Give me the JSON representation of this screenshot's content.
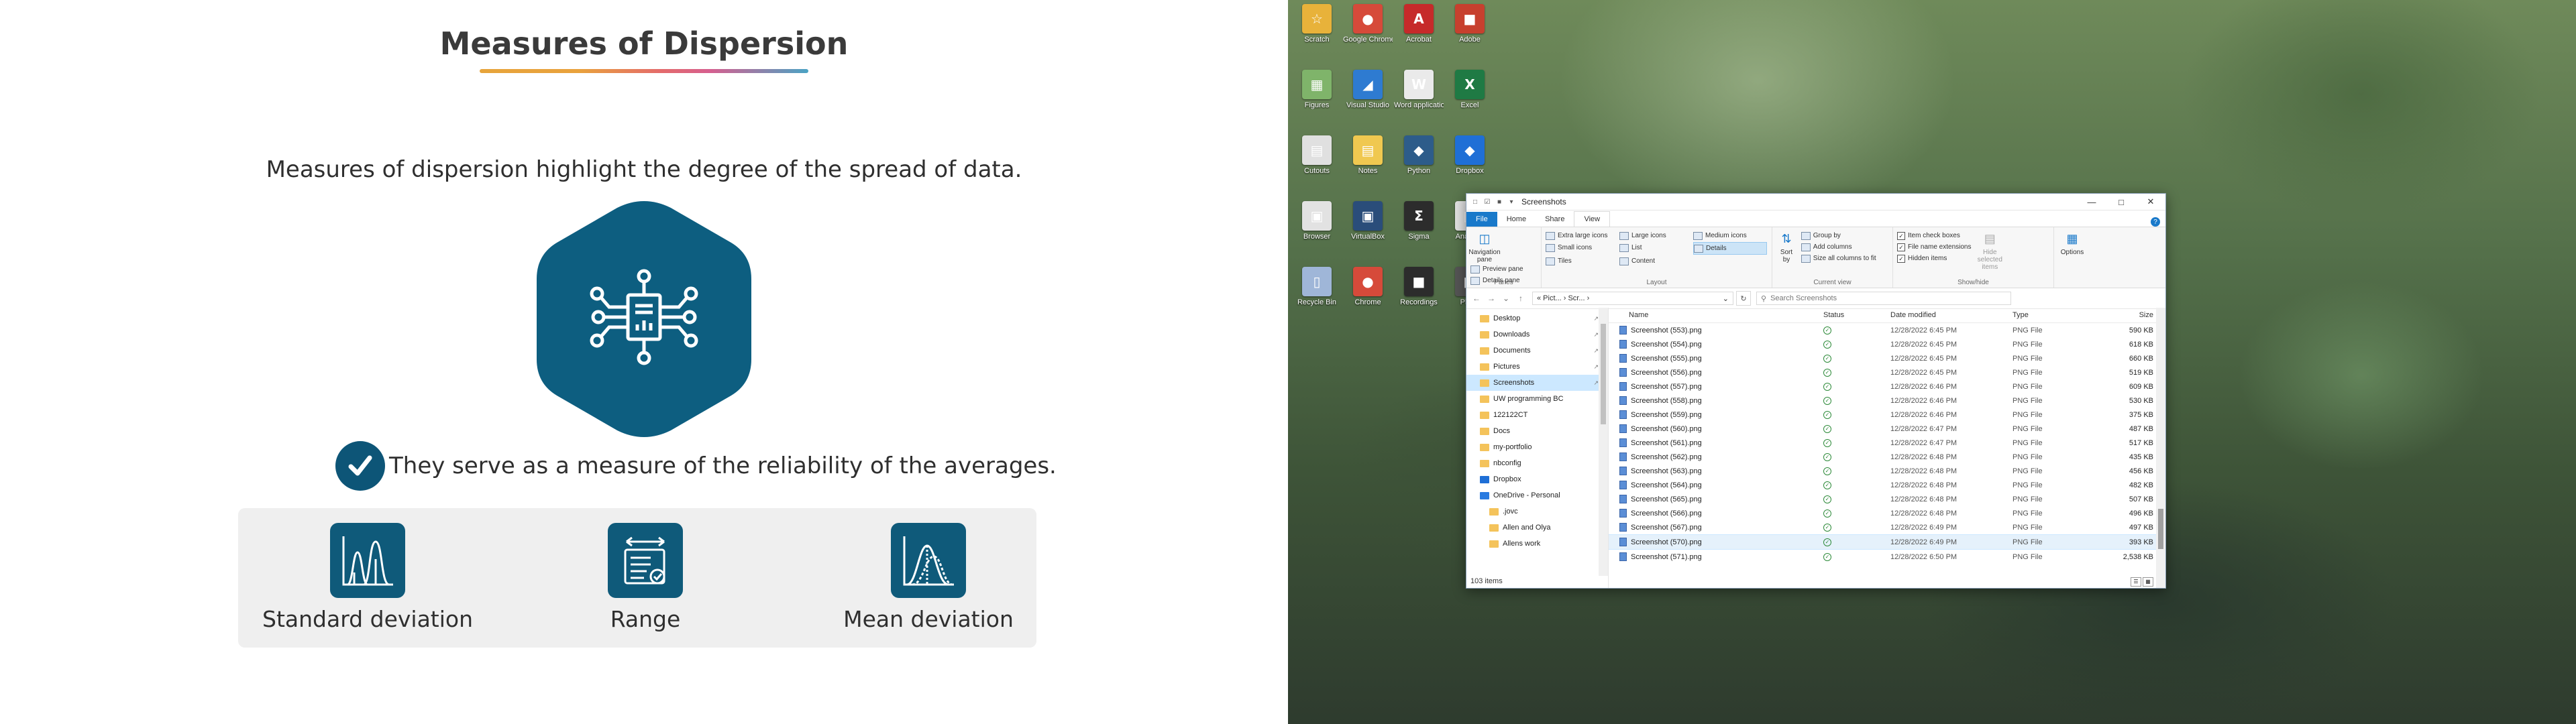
{
  "slide": {
    "title": "Measures of Dispersion",
    "lead": "Measures of dispersion highlight the degree of the spread of data.",
    "point": "They serve as a measure of the reliability of the averages.",
    "measures": [
      {
        "label": "Standard deviation",
        "icon": "bell-curves-icon"
      },
      {
        "label": "Range",
        "icon": "range-list-icon"
      },
      {
        "label": "Mean deviation",
        "icon": "distribution-curves-icon"
      }
    ],
    "colors": {
      "accent": "#0f5a7a",
      "panel": "#efefef"
    }
  },
  "desktop": {
    "icons": [
      {
        "label": "Scratch",
        "glyph": "☆",
        "color": "#e8b23a"
      },
      {
        "label": "Google Chrome",
        "glyph": "●",
        "color": "#d64a3a"
      },
      {
        "label": "Acrobat",
        "glyph": "A",
        "color": "#c62a2a"
      },
      {
        "label": "Adobe",
        "glyph": "■",
        "color": "#c7402e"
      },
      {
        "label": "Figures",
        "glyph": "▦",
        "color": "#7fb46a"
      },
      {
        "label": "Visual Studio",
        "glyph": "◢",
        "color": "#2e7bd1"
      },
      {
        "label": "Word application",
        "glyph": "W",
        "color": "#eaeaea"
      },
      {
        "label": "Excel",
        "glyph": "X",
        "color": "#1f7a44"
      },
      {
        "label": "Cutouts",
        "glyph": "▤",
        "color": "#e0e0e0"
      },
      {
        "label": "Notes",
        "glyph": "▤",
        "color": "#f0c850"
      },
      {
        "label": "Python",
        "glyph": "◆",
        "color": "#2d5c8a"
      },
      {
        "label": "Dropbox",
        "glyph": "◆",
        "color": "#1f6fd6"
      },
      {
        "label": "Browser",
        "glyph": "▣",
        "color": "#e2e2e2"
      },
      {
        "label": "VirtualBox",
        "glyph": "▣",
        "color": "#2a4d7a"
      },
      {
        "label": "Sigma",
        "glyph": "Σ",
        "color": "#2c2c2c"
      },
      {
        "label": "Analyser",
        "glyph": "▥",
        "color": "#e2e2e2"
      },
      {
        "label": "Recycle Bin",
        "glyph": "▯",
        "color": "#9fb6d8"
      },
      {
        "label": "Chrome",
        "glyph": "●",
        "color": "#d64a3a"
      },
      {
        "label": "Recordings",
        "glyph": "■",
        "color": "#2c2c2c"
      },
      {
        "label": "Photo",
        "glyph": "■",
        "color": "#555555"
      }
    ]
  },
  "explorer": {
    "window_title": "Screenshots",
    "tabs": [
      "File",
      "Home",
      "Share",
      "View"
    ],
    "ribbon": {
      "panes_label": "Panes",
      "nav_pane": "Navigation pane",
      "preview_pane": "Preview pane",
      "details_pane": "Details pane",
      "layout_label": "Layout",
      "layout_items": [
        "Extra large icons",
        "Large icons",
        "Medium icons",
        "Small icons",
        "List",
        "Details",
        "Tiles",
        "Content"
      ],
      "current_view_label": "Current view",
      "sort_by": "Sort by",
      "group_by": "Group by",
      "add_columns": "Add columns",
      "size_all_columns": "Size all columns to fit",
      "showhide_label": "Show/hide",
      "item_check_boxes": "Item check boxes",
      "file_name_extensions": "File name extensions",
      "hidden_items": "Hidden items",
      "hide_selected": "Hide selected items",
      "options": "Options"
    },
    "path": "« Pict... › Scr... ›",
    "search_placeholder": "Search Screenshots",
    "nav": [
      {
        "label": "Desktop",
        "pinned": true
      },
      {
        "label": "Downloads",
        "pinned": true
      },
      {
        "label": "Documents",
        "pinned": true
      },
      {
        "label": "Pictures",
        "pinned": true
      },
      {
        "label": "Screenshots",
        "pinned": true
      },
      {
        "label": "UW programming BC",
        "pinned": false
      },
      {
        "label": "122122CT",
        "pinned": false
      },
      {
        "label": "Docs",
        "pinned": false
      },
      {
        "label": "my-portfolio",
        "pinned": false
      },
      {
        "label": "nbconfig",
        "pinned": false
      },
      {
        "label": "Dropbox",
        "pinned": false
      },
      {
        "label": "OneDrive - Personal",
        "pinned": false
      },
      {
        "label": ".jovc",
        "pinned": false
      },
      {
        "label": "Allen and Olya",
        "pinned": false
      },
      {
        "label": "Allens work",
        "pinned": false
      }
    ],
    "item_count": "103 items",
    "columns": [
      "Name",
      "Status",
      "Date modified",
      "Type",
      "Size"
    ],
    "files": [
      {
        "name": "Screenshot (553).png",
        "date": "12/28/2022 6:45 PM",
        "type": "PNG File",
        "size": "590 KB"
      },
      {
        "name": "Screenshot (554).png",
        "date": "12/28/2022 6:45 PM",
        "type": "PNG File",
        "size": "618 KB"
      },
      {
        "name": "Screenshot (555).png",
        "date": "12/28/2022 6:45 PM",
        "type": "PNG File",
        "size": "660 KB"
      },
      {
        "name": "Screenshot (556).png",
        "date": "12/28/2022 6:45 PM",
        "type": "PNG File",
        "size": "519 KB"
      },
      {
        "name": "Screenshot (557).png",
        "date": "12/28/2022 6:46 PM",
        "type": "PNG File",
        "size": "609 KB"
      },
      {
        "name": "Screenshot (558).png",
        "date": "12/28/2022 6:46 PM",
        "type": "PNG File",
        "size": "530 KB"
      },
      {
        "name": "Screenshot (559).png",
        "date": "12/28/2022 6:46 PM",
        "type": "PNG File",
        "size": "375 KB"
      },
      {
        "name": "Screenshot (560).png",
        "date": "12/28/2022 6:47 PM",
        "type": "PNG File",
        "size": "487 KB"
      },
      {
        "name": "Screenshot (561).png",
        "date": "12/28/2022 6:47 PM",
        "type": "PNG File",
        "size": "517 KB"
      },
      {
        "name": "Screenshot (562).png",
        "date": "12/28/2022 6:48 PM",
        "type": "PNG File",
        "size": "435 KB"
      },
      {
        "name": "Screenshot (563).png",
        "date": "12/28/2022 6:48 PM",
        "type": "PNG File",
        "size": "456 KB"
      },
      {
        "name": "Screenshot (564).png",
        "date": "12/28/2022 6:48 PM",
        "type": "PNG File",
        "size": "482 KB"
      },
      {
        "name": "Screenshot (565).png",
        "date": "12/28/2022 6:48 PM",
        "type": "PNG File",
        "size": "507 KB"
      },
      {
        "name": "Screenshot (566).png",
        "date": "12/28/2022 6:48 PM",
        "type": "PNG File",
        "size": "496 KB"
      },
      {
        "name": "Screenshot (567).png",
        "date": "12/28/2022 6:49 PM",
        "type": "PNG File",
        "size": "497 KB"
      },
      {
        "name": "Screenshot (570).png",
        "date": "12/28/2022 6:49 PM",
        "type": "PNG File",
        "size": "393 KB"
      },
      {
        "name": "Screenshot (571).png",
        "date": "12/28/2022 6:50 PM",
        "type": "PNG File",
        "size": "2,538 KB"
      }
    ],
    "selected_file_index": 15
  }
}
